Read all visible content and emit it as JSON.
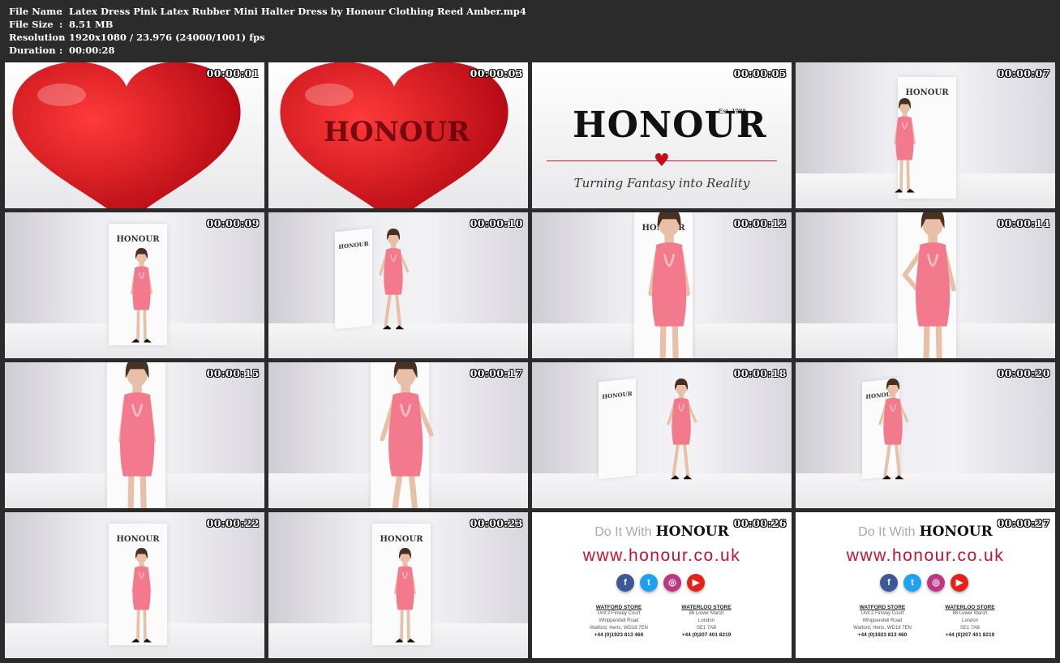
{
  "meta": {
    "rows": [
      {
        "label": "File Name",
        "sep": ":",
        "value": "Latex Dress  Pink Latex Rubber Mini Halter Dress by Honour Clothing  Reed Amber.mp4"
      },
      {
        "label": "File Size",
        "sep": ":",
        "value": "8.51 MB"
      },
      {
        "label": "Resolution",
        "sep": ":",
        "value": "1920x1080 / 23.976 (24000/1001) fps"
      },
      {
        "label": "Duration",
        "sep": ":",
        "value": "00:00:28"
      }
    ]
  },
  "thumbnails": [
    {
      "timestamp": "00:00:01",
      "scene": "heart"
    },
    {
      "timestamp": "00:00:03",
      "scene": "heart-logo",
      "logo": "HONOUR"
    },
    {
      "timestamp": "00:00:05",
      "scene": "brand",
      "logo": "HONOUR",
      "est": "Est. 1988",
      "tagline": "Turning Fantasy into Reality"
    },
    {
      "timestamp": "00:00:07",
      "scene": "studio-door",
      "logo": "HONOUR"
    },
    {
      "timestamp": "00:00:09",
      "scene": "studio-door",
      "logo": "HONOUR"
    },
    {
      "timestamp": "00:00:10",
      "scene": "studio-side",
      "logo": "HONOUR"
    },
    {
      "timestamp": "00:00:12",
      "scene": "studio-close",
      "logo": "HONOUR"
    },
    {
      "timestamp": "00:00:14",
      "scene": "studio-close"
    },
    {
      "timestamp": "00:00:15",
      "scene": "studio-close"
    },
    {
      "timestamp": "00:00:17",
      "scene": "studio-close"
    },
    {
      "timestamp": "00:00:18",
      "scene": "studio-side",
      "logo": "HONOUR"
    },
    {
      "timestamp": "00:00:20",
      "scene": "studio-side",
      "logo": "HONOUR"
    },
    {
      "timestamp": "00:00:22",
      "scene": "studio-door",
      "logo": "HONOUR"
    },
    {
      "timestamp": "00:00:23",
      "scene": "studio-door",
      "logo": "HONOUR"
    },
    {
      "timestamp": "00:00:26",
      "scene": "endcard"
    },
    {
      "timestamp": "00:00:27",
      "scene": "endcard"
    }
  ],
  "endcard": {
    "do_it": "Do It With",
    "brand": "HONOUR",
    "url": "www.honour.co.uk",
    "social": [
      "facebook-icon",
      "twitter-icon",
      "instagram-icon",
      "youtube-icon"
    ],
    "stores": [
      {
        "name": "WATFORD STORE",
        "lines": [
          "Unit 2 Finway Court",
          "Whippendell Road",
          "Watford, Herts, WD18 7EN"
        ],
        "phone": "+44 (0)1923 813 460"
      },
      {
        "name": "WATERLOO STORE",
        "lines": [
          "86 Lower Marsh",
          "London",
          "SE1 7AB"
        ],
        "phone": "+44 (0)207 401 8219"
      }
    ]
  },
  "colors": {
    "background": "#2b2b2b",
    "header_text": "#ffffff",
    "dress_pink": "#f27a8c",
    "heart_red": "#d0101c",
    "url_red": "#c8102e"
  }
}
